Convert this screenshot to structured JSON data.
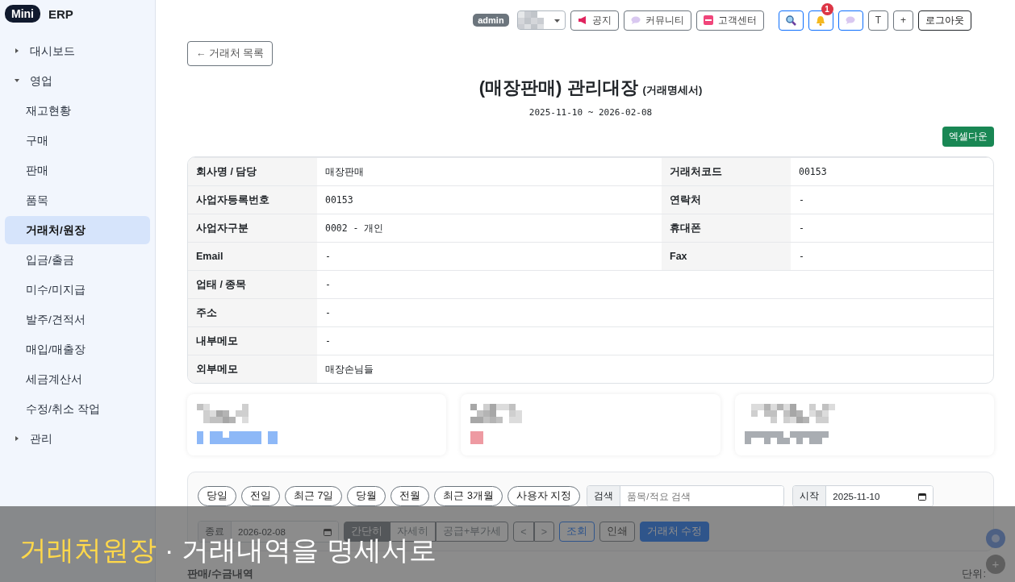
{
  "brand": {
    "badge": "Mini",
    "name": "ERP"
  },
  "sidebar": {
    "items": [
      {
        "label": "대시보드",
        "expanded": false,
        "selected": false
      },
      {
        "label": "영업",
        "expanded": true,
        "selected": false,
        "children": [
          {
            "label": "재고현황",
            "selected": false
          },
          {
            "label": "구매",
            "selected": false
          },
          {
            "label": "판매",
            "selected": false
          },
          {
            "label": "품목",
            "selected": false
          },
          {
            "label": "거래처/원장",
            "selected": true
          },
          {
            "label": "입금/출금",
            "selected": false
          },
          {
            "label": "미수/미지급",
            "selected": false
          },
          {
            "label": "발주/견적서",
            "selected": false
          },
          {
            "label": "매입/매출장",
            "selected": false
          },
          {
            "label": "세금계산서",
            "selected": false
          },
          {
            "label": "수정/취소 작업",
            "selected": false
          }
        ]
      },
      {
        "label": "관리",
        "expanded": false,
        "selected": false
      }
    ]
  },
  "topbar": {
    "role": "admin",
    "buttons": [
      {
        "kind": "megaphone",
        "label": "공지"
      },
      {
        "kind": "chat",
        "label": "커뮤니티"
      },
      {
        "kind": "sos",
        "label": "고객센터"
      },
      {
        "kind": "search"
      },
      {
        "kind": "bell",
        "badge": "1"
      },
      {
        "kind": "chat-blue"
      },
      {
        "kind": "text",
        "label": "T"
      },
      {
        "kind": "text",
        "label": "+"
      },
      {
        "kind": "dark",
        "label": "로그아웃"
      }
    ]
  },
  "back_button": "← 거래처 목록",
  "title": "(매장판매) 관리대장",
  "subtitle": "(거래명세서)",
  "period": "2025-11-10 ~ 2026-02-08",
  "excel_button": "엑셀다운",
  "info_rows": [
    [
      {
        "label": "회사명 / 담당",
        "value": "매장판매"
      },
      {
        "label": "거래처코드",
        "value": "00153"
      }
    ],
    [
      {
        "label": "사업자등록번호",
        "value": "00153"
      },
      {
        "label": "연락처",
        "value": "-"
      }
    ],
    [
      {
        "label": "사업자구분",
        "value": "0002 - 개인"
      },
      {
        "label": "휴대폰",
        "value": "-"
      }
    ],
    [
      {
        "label": "Email",
        "value": "-"
      },
      {
        "label": "Fax",
        "value": "-"
      }
    ],
    [
      {
        "label": "업태 / 종목",
        "value": "-"
      }
    ],
    [
      {
        "label": "주소",
        "value": "-"
      }
    ],
    [
      {
        "label": "내부메모",
        "value": "-"
      }
    ],
    [
      {
        "label": "외부메모",
        "value": "매장손님들"
      }
    ]
  ],
  "summary_cards": [
    {
      "color": "#8db8f7"
    },
    {
      "color": "#ee9aa2"
    },
    {
      "color": "#a9adb2"
    }
  ],
  "filter": {
    "ranges": [
      "당일",
      "전일",
      "최근 7일",
      "당월",
      "전월",
      "최근 3개월",
      "사용자 지정"
    ],
    "search": {
      "label": "검색",
      "placeholder": "품목/적요 검색"
    },
    "start": {
      "label": "시작",
      "value": "2025-11-10"
    },
    "end": {
      "label": "종료",
      "value": "2026-02-08"
    },
    "views": [
      {
        "label": "간단히",
        "selected": true
      },
      {
        "label": "자세히",
        "selected": false
      },
      {
        "label": "공급+부가세",
        "selected": false
      }
    ],
    "nav": [
      "<",
      ">"
    ],
    "actions": [
      {
        "kind": "outline-blue",
        "label": "조회"
      },
      {
        "kind": "outline-dark",
        "label": "인쇄"
      },
      {
        "kind": "primary",
        "label": "거래처 수정"
      }
    ]
  },
  "section": {
    "title": "판매/수금내역",
    "unit": "단위:"
  },
  "floating_add": "+",
  "caption": {
    "highlight": "거래처원장",
    "separator": "·",
    "text": "거래내역을 명세서로"
  }
}
